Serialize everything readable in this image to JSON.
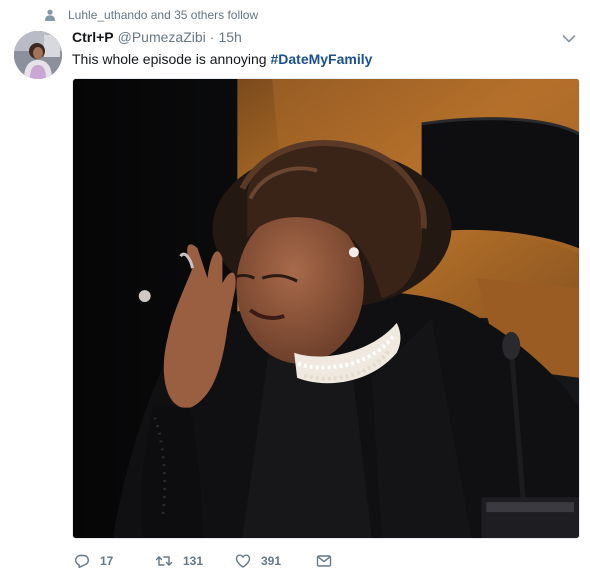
{
  "social_context": {
    "text": "Luhle_uthando and 35 others follow",
    "icon": "person-icon"
  },
  "tweet": {
    "display_name": "Ctrl+P",
    "handle": "@PumezaZibi",
    "separator": "·",
    "timestamp": "15h",
    "text_prefix": "This whole episode is annoying ",
    "hashtag": "#DateMyFamily",
    "hashtag_color": "#1b4f8f"
  },
  "actions": {
    "reply_count": "17",
    "retweet_count": "131",
    "like_count": "391",
    "icons": [
      "reply-icon",
      "retweet-icon",
      "heart-icon",
      "direct-message-icon"
    ]
  },
  "colors": {
    "muted": "#657786",
    "text": "#14171a"
  }
}
